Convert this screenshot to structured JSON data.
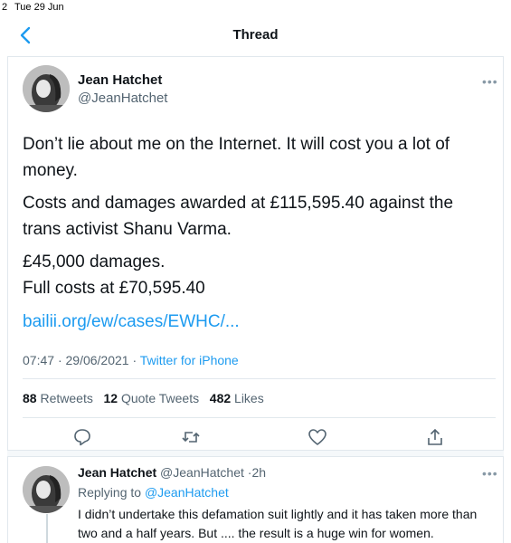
{
  "status_bar": {
    "left_fragment": "2",
    "date": "Tue 29 Jun"
  },
  "nav": {
    "title": "Thread",
    "back_icon": "chevron-left"
  },
  "tweet": {
    "author_name": "Jean Hatchet",
    "author_handle": "@JeanHatchet",
    "paragraph_1": "Don’t lie about me on the Internet. It will cost you a lot of money.",
    "paragraph_2": "Costs and damages awarded at £115,595.40 against the trans activist Shanu Varma.",
    "paragraph_3_line1": "£45,000 damages.",
    "paragraph_3_line2": "Full costs at £70,595.40",
    "link": "bailii.org/ew/cases/EWHC/...",
    "time": "07:47",
    "date": "29/06/2021",
    "source": "Twitter for iPhone",
    "retweets_count": "88",
    "retweets_label": "Retweets",
    "quotes_count": "12",
    "quotes_label": "Quote Tweets",
    "likes_count": "482",
    "likes_label": "Likes",
    "more": "•••"
  },
  "reply": {
    "author_name": "Jean Hatchet",
    "author_handle": "@JeanHatchet",
    "age": "2h",
    "replying_prefix": "Replying to",
    "replying_handle": "@JeanHatchet",
    "text": "I didn’t undertake this defamation suit lightly and it has taken more than two and a half years. But .... the result is a huge win for women.",
    "more": "•••"
  },
  "colors": {
    "accent": "#1d9bf0",
    "muted": "#536471",
    "text": "#0f1419",
    "border": "#e1e8ed"
  },
  "icons": [
    "chevron-left-icon",
    "reply-icon",
    "retweet-icon",
    "like-icon",
    "share-icon",
    "more-icon"
  ]
}
